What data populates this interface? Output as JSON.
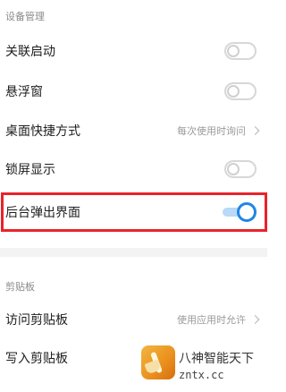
{
  "sections": {
    "device": {
      "title": "设备管理"
    },
    "clipboard": {
      "title": "剪贴板"
    }
  },
  "rows": {
    "associated_start": {
      "label": "关联启动",
      "toggle_on": false
    },
    "floating_window": {
      "label": "悬浮窗",
      "toggle_on": false
    },
    "desktop_shortcut": {
      "label": "桌面快捷方式",
      "value": "每次使用时询问"
    },
    "lock_screen_display": {
      "label": "锁屏显示",
      "toggle_on": false
    },
    "background_popup": {
      "label": "后台弹出界面",
      "toggle_on": true
    },
    "access_clipboard": {
      "label": "访问剪贴板",
      "value": "使用应用时允许"
    },
    "write_clipboard": {
      "label": "写入剪贴板"
    }
  },
  "watermark": {
    "title": "八神智能天下",
    "url": "zntx.cc"
  },
  "colors": {
    "accent": "#1e86e6",
    "highlight": "#e8232b",
    "toggle_off": "#d7d7d7",
    "secondary_text": "#9a9a9a"
  }
}
